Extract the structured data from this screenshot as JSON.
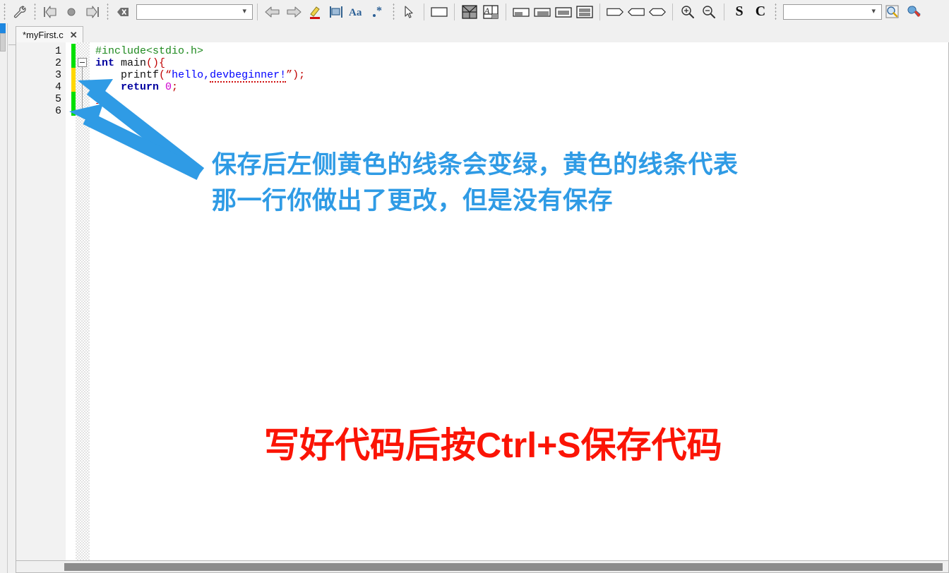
{
  "toolbar": {
    "groups": [
      {
        "name": "tools-group",
        "items": [
          {
            "icon": "wrench-icon",
            "label": "Configure tools"
          }
        ]
      },
      {
        "name": "navigation-group",
        "items": [
          {
            "icon": "goto-start-icon",
            "label": "Go to start"
          },
          {
            "icon": "record-dot-icon",
            "label": "Record"
          },
          {
            "icon": "goto-end-icon",
            "label": "Go to end"
          }
        ]
      },
      {
        "name": "find-group",
        "items": [
          {
            "icon": "clear-find-icon",
            "label": "Clear find"
          },
          {
            "icon": "find-combo",
            "label": "",
            "value": "",
            "placeholder": ""
          },
          {
            "icon": "find-previous-icon",
            "label": "Find previous"
          },
          {
            "icon": "find-next-icon",
            "label": "Find next"
          },
          {
            "icon": "highlight-icon",
            "label": "Highlight all"
          },
          {
            "icon": "incremental-search-icon",
            "label": "Incremental search"
          },
          {
            "icon": "match-case-icon",
            "label": "Match case"
          },
          {
            "icon": "regex-icon",
            "label": "Regular expression"
          }
        ]
      },
      {
        "name": "layout-group",
        "items": [
          {
            "icon": "pointer-icon",
            "label": "Select"
          },
          {
            "icon": "single-pane-icon",
            "label": "Single pane"
          },
          {
            "icon": "split-quad-icon",
            "label": "Split into four"
          },
          {
            "icon": "split-diagonal-icon",
            "label": "Diagonal split"
          },
          {
            "icon": "dock-bottom-left-icon",
            "label": "Dock bottom left"
          },
          {
            "icon": "dock-bottom-right-icon",
            "label": "Dock bottom right"
          },
          {
            "icon": "dock-bottom-wide-icon",
            "label": "Dock bottom wide"
          },
          {
            "icon": "dock-full-icon",
            "label": "Dock full"
          },
          {
            "icon": "tag-right-icon",
            "label": "Tag right"
          },
          {
            "icon": "tag-left-icon",
            "label": "Tag left"
          },
          {
            "icon": "tag-both-icon",
            "label": "Tag both"
          },
          {
            "icon": "zoom-in-icon",
            "label": "Zoom in"
          },
          {
            "icon": "zoom-out-icon",
            "label": "Zoom out"
          },
          {
            "icon": "letter-s-icon",
            "label": "S"
          },
          {
            "icon": "letter-c-icon",
            "label": "C"
          }
        ]
      },
      {
        "name": "compile-group",
        "items": [
          {
            "icon": "compiler-combo",
            "label": "",
            "value": "",
            "placeholder": ""
          },
          {
            "icon": "inspect-icon",
            "label": "Inspect"
          },
          {
            "icon": "wrench-red-icon",
            "label": "Compiler options"
          }
        ]
      }
    ],
    "letter_s": "S",
    "letter_c": "C",
    "find_value": "",
    "compiler_value": ""
  },
  "tab": {
    "label": "*myFirst.c",
    "close": "✕",
    "modified": true
  },
  "editor": {
    "line_numbers": [
      "1",
      "2",
      "3",
      "4",
      "5",
      "6"
    ],
    "change_marks": [
      {
        "line": 1,
        "state": "saved",
        "color": "#00e000"
      },
      {
        "line": 2,
        "state": "saved",
        "color": "#00e000"
      },
      {
        "line": 3,
        "state": "unsaved",
        "color": "#ffd800"
      },
      {
        "line": 4,
        "state": "unsaved",
        "color": "#ffd800"
      },
      {
        "line": 5,
        "state": "saved",
        "color": "#00e000"
      },
      {
        "line": 6,
        "state": "saved",
        "color": "#00e000"
      }
    ],
    "lines": [
      {
        "n": "1",
        "text": "#include<stdio.h>"
      },
      {
        "n": "2",
        "text": "int main(){"
      },
      {
        "n": "3",
        "text": "    printf(“hello,devbeginner!”);"
      },
      {
        "n": "4",
        "text": "    return 0;"
      },
      {
        "n": "5",
        "text": "}"
      },
      {
        "n": "6",
        "text": ""
      }
    ],
    "tokens": {
      "l1_include": "#include<stdio.h>",
      "l2_int": "int",
      "l2_main": " main",
      "l2_parens": "()",
      "l2_brace": "{",
      "l3_printf": "printf",
      "l3_open": "(",
      "l3_q1": "“",
      "l3_str": "hello,",
      "l3_str_word": "devbeginner!",
      "l3_q2": "”",
      "l3_close": ")",
      "l3_semi": ";",
      "l4_return": "return",
      "l4_zero": " 0",
      "l4_semi": ";",
      "l5_brace": "}"
    }
  },
  "scrollbar": {
    "orientation": "horizontal",
    "thumb_label": "horizontal-scroll-thumb"
  },
  "annotations": {
    "blue_note_line1": "保存后左侧黄色的线条会变绿，黄色的线条代表",
    "blue_note_line2": "那一行你做出了更改，但是没有保存",
    "red_note": "写好代码后按Ctrl+S保存代码",
    "blue_color": "#2f9be5",
    "red_color": "#fb1405",
    "arrow_count": 2
  }
}
